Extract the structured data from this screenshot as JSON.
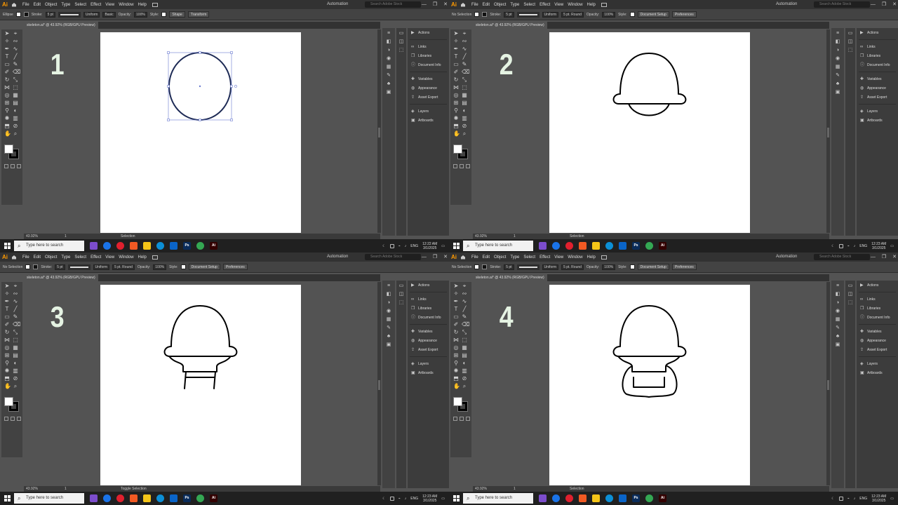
{
  "app": {
    "logo": "Ai"
  },
  "menus": [
    "File",
    "Edit",
    "Object",
    "Type",
    "Select",
    "Effect",
    "View",
    "Window",
    "Help"
  ],
  "workspace": "Automation",
  "search_placeholder": "Search Adobe Stock",
  "window_controls": [
    "—",
    "❐",
    "✕"
  ],
  "panel_items": [
    {
      "icon": "play-icon",
      "label": "Actions"
    },
    {
      "icon": "link-icon",
      "label": "Links"
    },
    {
      "icon": "library-icon",
      "label": "Libraries"
    },
    {
      "icon": "info-icon",
      "label": "Document Info"
    },
    {
      "icon": "variables-icon",
      "label": "Variables"
    },
    {
      "icon": "appearance-icon",
      "label": "Appearance"
    },
    {
      "icon": "export-icon",
      "label": "Asset Export"
    },
    {
      "icon": "layers-icon",
      "label": "Layers"
    },
    {
      "icon": "artboards-icon",
      "label": "Artboards"
    }
  ],
  "taskbar": {
    "search_placeholder": "Type here to search",
    "tray_lang": "ENG",
    "apps": [
      {
        "name": "clipchamp",
        "color": "#7c4dcc"
      },
      {
        "name": "chrome",
        "color": "#1a73e8"
      },
      {
        "name": "opera",
        "color": "#e0202e"
      },
      {
        "name": "brave",
        "color": "#f25a23"
      },
      {
        "name": "explorer",
        "color": "#f5c518"
      },
      {
        "name": "edge",
        "color": "#0c8fd6"
      },
      {
        "name": "outlook",
        "color": "#0a64c8"
      },
      {
        "name": "photoshop",
        "color": "#0a2c5a",
        "label": "Ps"
      },
      {
        "name": "chrome-2",
        "color": "#34a853"
      },
      {
        "name": "illustrator",
        "color": "#330000",
        "label": "Ai"
      }
    ]
  },
  "quadrants": [
    {
      "key": "q1",
      "step": "1",
      "zoom": "43.92%",
      "page": "1",
      "mode": "Selection",
      "doc_tab": "skeleton.ai* @ 43.92% (RGB/GPU Preview)",
      "ctrl": {
        "sel": "Ellipse",
        "stroke_label": "Stroke:",
        "stroke_weight": "5 pt",
        "profile": "Uniform",
        "brush": "Basic",
        "opacity_label": "Opacity:",
        "opacity": "100%",
        "style_label": "Style:",
        "btn1": "Shape",
        "btn2": "Transform"
      },
      "clock": {
        "time": "12:22 AM",
        "date": "3/1/2025"
      }
    },
    {
      "key": "q2",
      "step": "2",
      "zoom": "43.92%",
      "page": "1",
      "mode": "Selection",
      "doc_tab": "skeleton.ai* @ 43.92% (RGB/GPU Preview)",
      "ctrl": {
        "sel": "No Selection",
        "stroke_label": "Stroke:",
        "stroke_weight": "5 pt",
        "profile": "Uniform",
        "brush": "5 pt. Round",
        "opacity_label": "Opacity:",
        "opacity": "100%",
        "style_label": "Style:",
        "btn1": "Document Setup",
        "btn2": "Preferences"
      },
      "clock": {
        "time": "12:23 AM",
        "date": "3/1/2025"
      }
    },
    {
      "key": "q3",
      "step": "3",
      "zoom": "43.92%",
      "page": "1",
      "mode": "Toggle Selection",
      "doc_tab": "skeleton.ai* @ 43.92% (RGB/GPU Preview)",
      "ctrl": {
        "sel": "No Selection",
        "stroke_label": "Stroke:",
        "stroke_weight": "5 pt",
        "profile": "Uniform",
        "brush": "5 pt. Round",
        "opacity_label": "Opacity:",
        "opacity": "100%",
        "style_label": "Style:",
        "btn1": "Document Setup",
        "btn2": "Preferences"
      },
      "clock": {
        "time": "12:23 AM",
        "date": "3/1/2025"
      }
    },
    {
      "key": "q4",
      "step": "4",
      "zoom": "43.92%",
      "page": "1",
      "mode": "Selection",
      "doc_tab": "skeleton.ai* @ 43.92% (RGB/GPU Preview)",
      "ctrl": {
        "sel": "No Selection",
        "stroke_label": "Stroke:",
        "stroke_weight": "5 pt",
        "profile": "Uniform",
        "brush": "5 pt. Round",
        "opacity_label": "Opacity:",
        "opacity": "100%",
        "style_label": "Style:",
        "btn1": "Document Setup",
        "btn2": "Preferences"
      },
      "clock": {
        "time": "12:23 AM",
        "date": "3/1/2025"
      }
    }
  ]
}
